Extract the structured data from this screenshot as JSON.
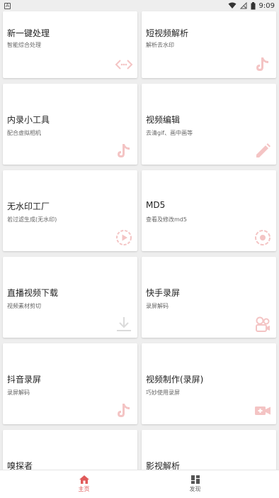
{
  "status": {
    "time": "9:09"
  },
  "cards": [
    {
      "title": "新一键处理",
      "subtitle": "智能综合处理",
      "icon": "code-arrows-icon"
    },
    {
      "title": "短视频解析",
      "subtitle": "解析去水印",
      "icon": "tiktok-icon"
    },
    {
      "title": "内录小工具",
      "subtitle": "配合虚拟相机",
      "icon": "tiktok-icon"
    },
    {
      "title": "视频编辑",
      "subtitle": "去清gif、画中画等",
      "icon": "pencil-icon"
    },
    {
      "title": "无水印工厂",
      "subtitle": "若过滤生成(无水印)",
      "icon": "play-circle-icon"
    },
    {
      "title": "MD5",
      "subtitle": "查看及修改md5",
      "icon": "settings-circle-icon"
    },
    {
      "title": "直播视频下载",
      "subtitle": "视频素材剪切",
      "icon": "download-icon"
    },
    {
      "title": "快手录屏",
      "subtitle": "录屏解码",
      "icon": "camera-reel-icon"
    },
    {
      "title": "抖音录屏",
      "subtitle": "录屏解码",
      "icon": "tiktok-icon"
    },
    {
      "title": "视频制作(录屏)",
      "subtitle": "巧妙使用录屏",
      "icon": "video-plus-icon"
    },
    {
      "title": "嗅探者",
      "subtitle": "",
      "icon": ""
    },
    {
      "title": "影视解析",
      "subtitle": "",
      "icon": ""
    }
  ],
  "nav": {
    "home_label": "主页",
    "discover_label": "发现"
  },
  "colors": {
    "accent": "#e05a5a",
    "icon_tint": "#f2a6ad"
  }
}
